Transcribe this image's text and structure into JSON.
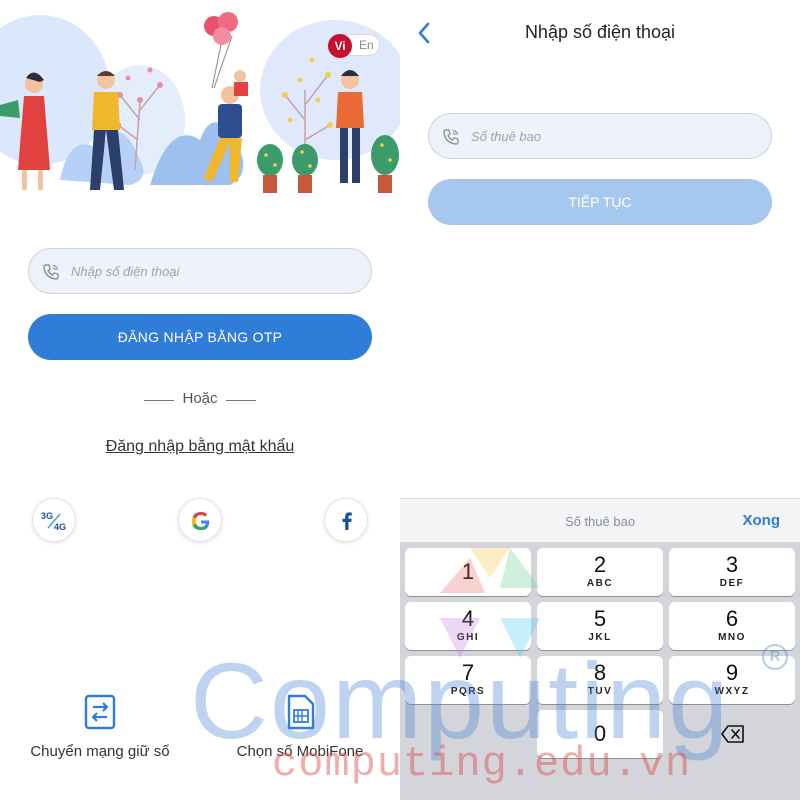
{
  "login_screen": {
    "language": {
      "vi": "Vi",
      "en": "En",
      "selected": "Vi"
    },
    "phone_input": {
      "placeholder": "Nhập số điện thoại"
    },
    "otp_button": "ĐĂNG NHẬP BẰNG OTP",
    "divider_text": "Hoặc",
    "password_link": "Đăng nhập bằng mật khẩu",
    "social": {
      "net_3g": "3G",
      "net_4g": "4G"
    },
    "bottom_actions": [
      {
        "label": "Chuyển mạng giữ số",
        "icon": "swap-network-icon"
      },
      {
        "label": "Chọn số MobiFone",
        "icon": "sim-card-icon"
      }
    ]
  },
  "phone_screen": {
    "title": "Nhập số điện thoại",
    "subscriber_input": {
      "placeholder": "Số thuê bao"
    },
    "continue_button": "TIẾP TỤC",
    "keyboard": {
      "hint": "Số thuê bao",
      "done": "Xong",
      "keys": [
        {
          "digit": "1",
          "letters": ""
        },
        {
          "digit": "2",
          "letters": "ABC"
        },
        {
          "digit": "3",
          "letters": "DEF"
        },
        {
          "digit": "4",
          "letters": "GHI"
        },
        {
          "digit": "5",
          "letters": "JKL"
        },
        {
          "digit": "6",
          "letters": "MNO"
        },
        {
          "digit": "7",
          "letters": "PQRS"
        },
        {
          "digit": "8",
          "letters": "TUV"
        },
        {
          "digit": "9",
          "letters": "WXYZ"
        },
        {
          "digit": "0",
          "letters": ""
        }
      ]
    }
  },
  "watermark": {
    "brand": "Computing",
    "registered": "R",
    "url": "computing.edu.vn"
  },
  "colors": {
    "primary": "#2f7dd6",
    "primary_disabled": "#a6c8ef",
    "input_bg": "#eef2fb",
    "lang_active": "#c8102e",
    "keypad_bg": "#d3d5db"
  }
}
